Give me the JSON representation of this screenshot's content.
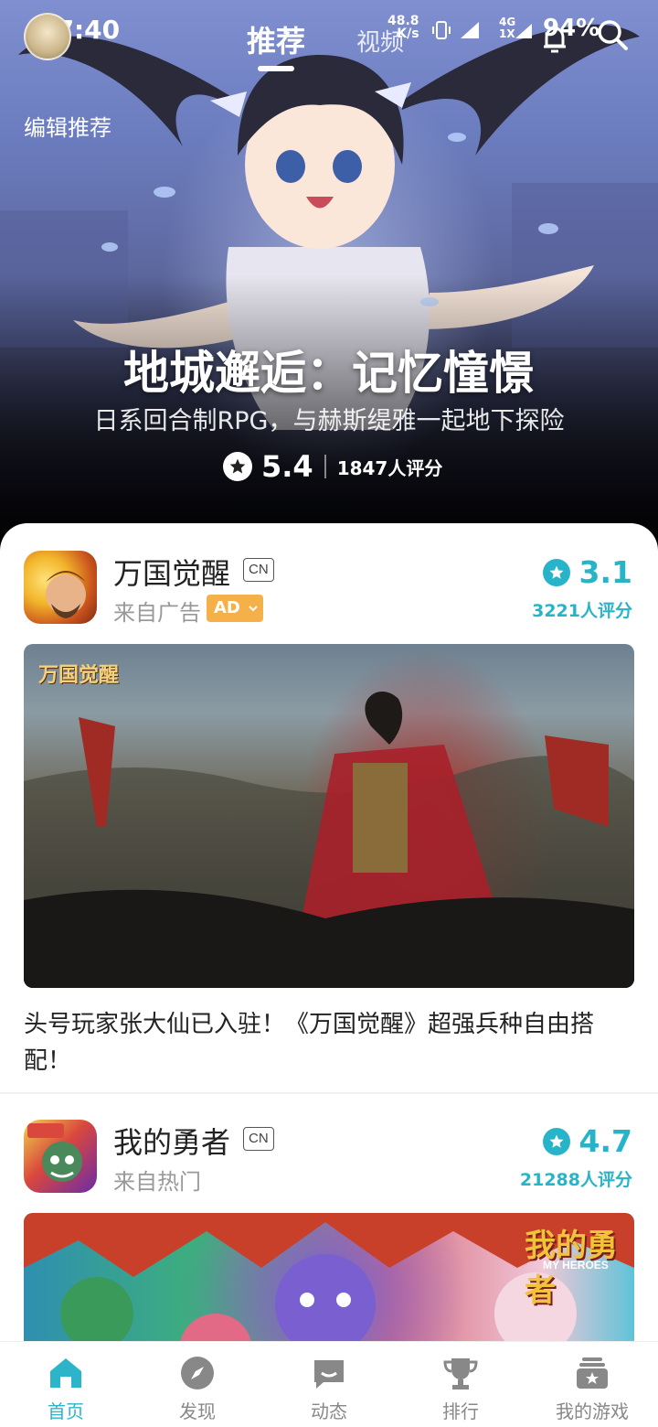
{
  "status_bar": {
    "time": "07:40",
    "net_speed_value": "48.8",
    "net_speed_unit": "K/s",
    "network_type_top": "4G",
    "network_type_bottom": "1X",
    "battery": "94%"
  },
  "header": {
    "tabs": [
      {
        "label": "推荐",
        "active": true
      },
      {
        "label": "视频",
        "active": false
      }
    ]
  },
  "hero": {
    "section_label": "编辑推荐",
    "title": "地城邂逅：记忆憧憬",
    "subtitle": "日系回合制RPG，与赫斯缇雅一起地下探险",
    "score": "5.4",
    "rating_count": "1847人评分"
  },
  "feed": {
    "cards": [
      {
        "name": "万国觉醒",
        "region_badge": "CN",
        "source": "来自广告",
        "ad_badge": "AD",
        "score": "3.1",
        "rating_count": "3221人评分",
        "banner_logo": "万国觉醒",
        "description": "头号玩家张大仙已入驻！《万国觉醒》超强兵种自由搭配！"
      },
      {
        "name": "我的勇者",
        "region_badge": "CN",
        "source": "来自热门",
        "score": "4.7",
        "rating_count": "21288人评分",
        "banner_logo": "我的勇者",
        "banner_logo_sub": "MY HEROES"
      }
    ]
  },
  "bottom_nav": {
    "items": [
      {
        "label": "首页",
        "icon": "home-icon",
        "active": true
      },
      {
        "label": "发现",
        "icon": "compass-icon",
        "active": false
      },
      {
        "label": "动态",
        "icon": "message-icon",
        "active": false
      },
      {
        "label": "排行",
        "icon": "trophy-icon",
        "active": false
      },
      {
        "label": "我的游戏",
        "icon": "game-library-icon",
        "active": false
      }
    ]
  },
  "colors": {
    "accent": "#2cb5c9",
    "rating": "#28b4c8",
    "ad_badge": "#f5b04a"
  }
}
